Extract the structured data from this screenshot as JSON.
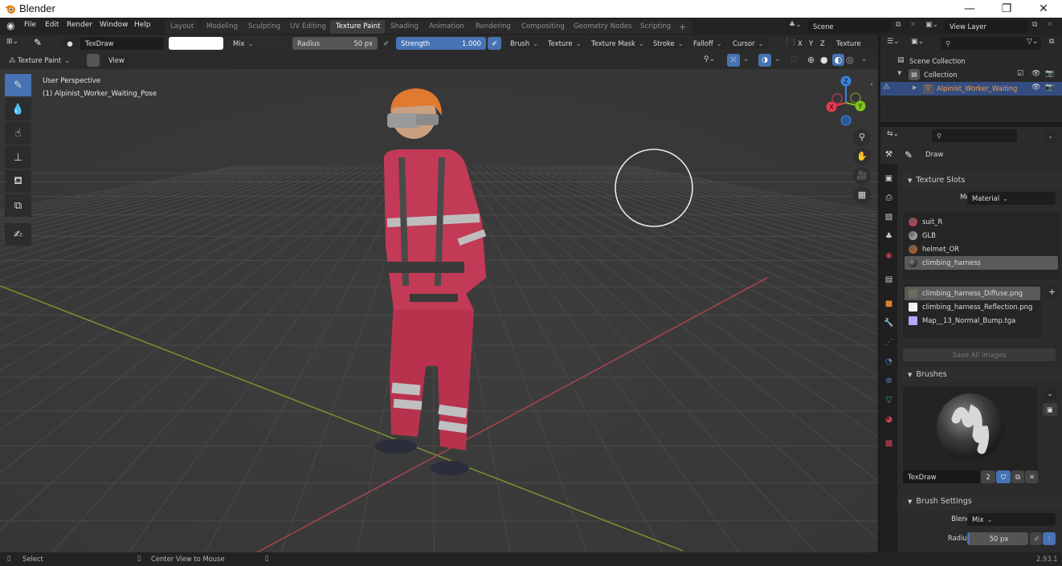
{
  "window": {
    "title": "Blender",
    "controls": {
      "minimize": "—",
      "maximize": "❐",
      "close": "✕"
    }
  },
  "menubar": {
    "items": [
      "File",
      "Edit",
      "Render",
      "Window",
      "Help"
    ],
    "workspaces": [
      "Layout",
      "Modeling",
      "Sculpting",
      "UV Editing",
      "Texture Paint",
      "Shading",
      "Animation",
      "Rendering",
      "Compositing",
      "Geometry Nodes",
      "Scripting"
    ],
    "active_workspace": "Texture Paint",
    "add_tab": "+",
    "scene": "Scene",
    "view_layer": "View Layer"
  },
  "tool_header": {
    "brush_name": "TexDraw",
    "color_hex": "#ffffff",
    "blend": "Mix",
    "radius_label": "Radius",
    "radius_value": "50 px",
    "strength_label": "Strength",
    "strength_value": "1.000",
    "menus": [
      "Brush",
      "Texture",
      "Texture Mask",
      "Stroke",
      "Falloff",
      "Cursor"
    ],
    "axes": [
      "X",
      "Y",
      "Z"
    ],
    "texture_slots": "Texture Slots"
  },
  "view_header": {
    "mode": "Texture Paint",
    "view_menu": "View"
  },
  "viewport": {
    "perspective": "User Perspective",
    "object": "(1) Alpinist_Worker_Waiting_Pose",
    "gizmo_axes": [
      "X",
      "Y",
      "Z"
    ],
    "colors": {
      "x_axis": "#e8394f",
      "y_axis": "#7fc41a",
      "z_axis": "#3b82e0",
      "grid_x": "#b5454f",
      "grid_y": "#7a9a2e"
    }
  },
  "tools": [
    "draw",
    "soften",
    "smear",
    "clone",
    "fill",
    "mask",
    "annotate"
  ],
  "outliner": {
    "search_placeholder": "",
    "scene_collection": "Scene Collection",
    "collection": "Collection",
    "object": "Alpinist_Worker_Waiting"
  },
  "properties": {
    "search_placeholder": "",
    "tool_name": "Draw",
    "texture_slots": {
      "title": "Texture Slots",
      "mode_label": "Mode",
      "mode_value": "Material",
      "materials": [
        {
          "name": "suit_R",
          "color": "#c04050"
        },
        {
          "name": "GLB",
          "color": "#a0a0a0"
        },
        {
          "name": "helmet_OR",
          "color": "#b05a20"
        },
        {
          "name": "climbing_harness",
          "color": "#333333",
          "selected": true
        }
      ],
      "images": [
        {
          "name": "climbing_harness_Diffuse.png",
          "color": "#6a6e58",
          "selected": true
        },
        {
          "name": "climbing_harness_Reflection.png",
          "color": "#f2f2f2"
        },
        {
          "name": "Map__13_Normal_Bump.tga",
          "color": "#b0a8ff"
        }
      ],
      "save_all": "Save All Images",
      "add": "+"
    },
    "brushes": {
      "title": "Brushes",
      "name": "TexDraw",
      "users": "2"
    },
    "brush_settings": {
      "title": "Brush Settings",
      "blend_label": "Blend",
      "blend_value": "Mix",
      "radius_label": "Radius",
      "radius_value": "50 px"
    }
  },
  "statusbar": {
    "select": "Select",
    "center": "Center View to Mouse",
    "version": "2.93.1"
  }
}
